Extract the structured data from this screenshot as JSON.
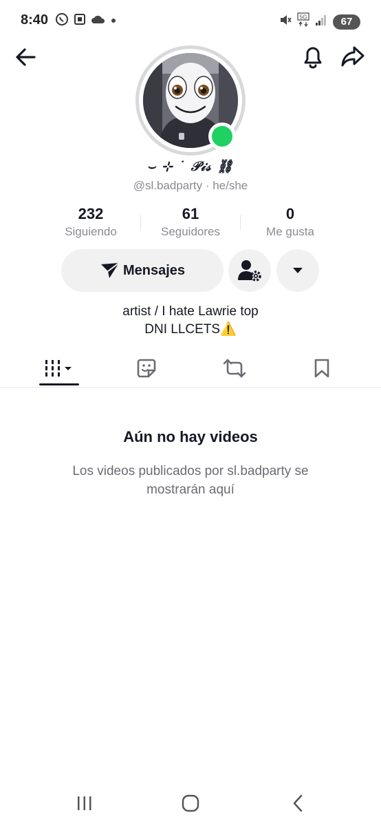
{
  "status_bar": {
    "time": "8:40",
    "battery": "67",
    "network": "5G",
    "left_icons": [
      "whatsapp-icon",
      "screenshot-icon",
      "cloud-icon",
      "dot-icon"
    ],
    "right_icons": [
      "mute-icon",
      "5g-icon",
      "signal-icon",
      "battery-icon"
    ]
  },
  "nav": {
    "back_icon": "arrow-left-icon",
    "bell_icon": "bell-icon",
    "share_icon": "share-icon"
  },
  "profile": {
    "display_name": "⌣ ⊹ ˙ 𝒫𝒾𝓈   ⛓",
    "handle": "@sl.badparty · he/she",
    "online_color": "#1fd063"
  },
  "stats": [
    {
      "value": "232",
      "label": "Siguiendo"
    },
    {
      "value": "61",
      "label": "Seguidores"
    },
    {
      "value": "0",
      "label": "Me gusta"
    }
  ],
  "actions": {
    "message_label": "Mensajes",
    "add_user_icon": "person-gear-icon",
    "more_icon": "caret-down-icon"
  },
  "bio": {
    "line1": "artist / I hate Lawrie top",
    "line2": "DNI LLCETS⚠️"
  },
  "tabs": [
    {
      "name": "videos",
      "icon": "grid-icon",
      "active": true
    },
    {
      "name": "stickers",
      "icon": "sticker-icon",
      "active": false
    },
    {
      "name": "reposts",
      "icon": "repost-icon",
      "active": false
    },
    {
      "name": "saved",
      "icon": "bookmark-icon",
      "active": false
    }
  ],
  "empty_state": {
    "title": "Aún no hay videos",
    "subtitle": "Los videos publicados por sl.badparty se mostrarán aquí"
  },
  "android_nav": [
    "recents-icon",
    "home-icon",
    "back-icon"
  ],
  "colors": {
    "text": "#161823",
    "secondary": "#8a8b91",
    "button_bg": "#f1f1f2"
  }
}
